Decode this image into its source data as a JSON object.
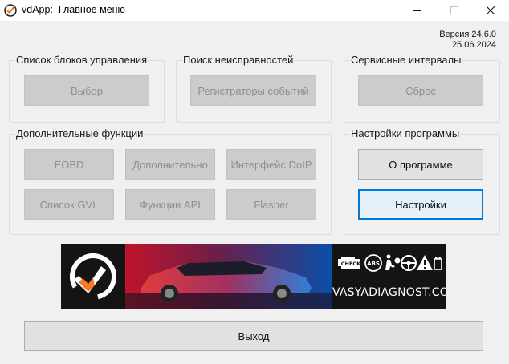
{
  "window": {
    "app_name": "vdApp:",
    "title": "Главное меню",
    "app_icon": "vdapp-logo-icon",
    "controls": [
      "minimize-icon",
      "maximize-icon",
      "close-icon"
    ]
  },
  "version": {
    "label": "Версия 24.6.0",
    "date": "25.06.2024"
  },
  "groups": {
    "control_units": {
      "title": "Список блоков управления",
      "buttons": {
        "select": "Выбор"
      }
    },
    "fault_search": {
      "title": "Поиск неисправностей",
      "buttons": {
        "event_recorders": "Регистраторы событий"
      }
    },
    "service_intervals": {
      "title": "Сервисные интервалы",
      "buttons": {
        "reset": "Сброс"
      }
    },
    "extra_functions": {
      "title": "Дополнительные функции",
      "buttons": {
        "eobd": "EOBD",
        "additional": "Дополнительно",
        "doip": "Интерфейс DoIP",
        "gvl_list": "Список GVL",
        "api_functions": "Функции API",
        "flasher": "Flasher"
      }
    },
    "program_settings": {
      "title": "Настройки программы",
      "buttons": {
        "about": "О программе",
        "settings": "Настройки"
      }
    }
  },
  "banner": {
    "url": "VASYADIAGNOST.COM",
    "check_label": "CHECK",
    "abs_label": "ABS",
    "icons": [
      "check-engine-icon",
      "abs-icon",
      "airbag-icon",
      "steering-wheel-icon",
      "warning-icon",
      "battery-icon"
    ]
  },
  "footer": {
    "exit": "Выход"
  },
  "colors": {
    "accent": "#0078d7",
    "logo_orange": "#f47b20",
    "disabled_button": "#cccccc",
    "window_background": "#f0f0f0"
  }
}
